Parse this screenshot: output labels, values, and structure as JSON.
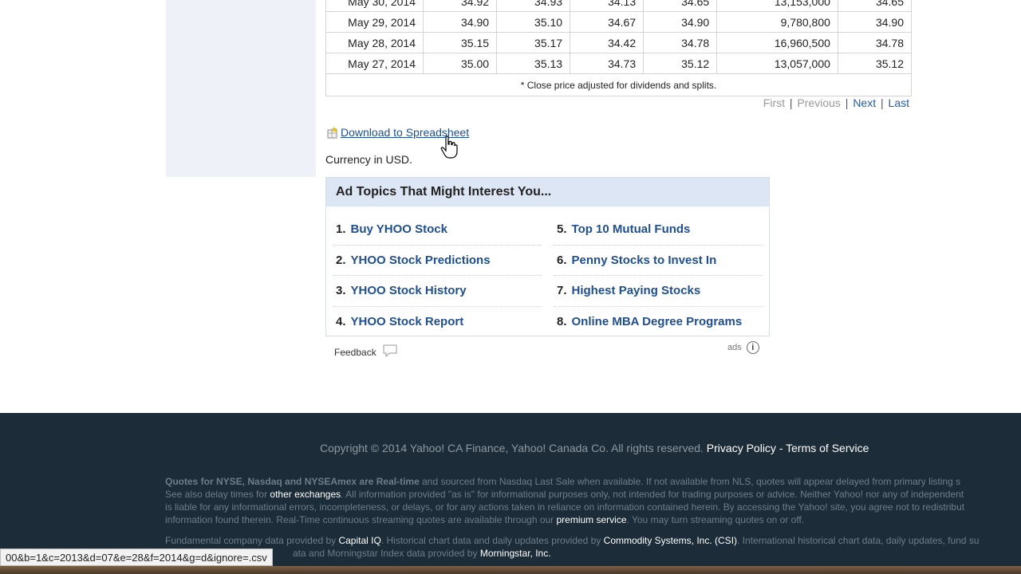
{
  "history_table": {
    "rows": [
      {
        "date": "May 30, 2014",
        "open": "34.92",
        "high": "34.93",
        "low": "34.13",
        "close": "34.65",
        "volume": "13,153,000",
        "adj_close": "34.65"
      },
      {
        "date": "May 29, 2014",
        "open": "34.90",
        "high": "35.10",
        "low": "34.67",
        "close": "34.90",
        "volume": "9,780,800",
        "adj_close": "34.90"
      },
      {
        "date": "May 28, 2014",
        "open": "35.15",
        "high": "35.17",
        "low": "34.42",
        "close": "34.78",
        "volume": "16,960,500",
        "adj_close": "34.78"
      },
      {
        "date": "May 27, 2014",
        "open": "35.00",
        "high": "35.13",
        "low": "34.73",
        "close": "35.12",
        "volume": "13,057,000",
        "adj_close": "35.12"
      }
    ],
    "footnote": "* Close price adjusted for dividends and splits."
  },
  "pager": {
    "first": "First",
    "previous": "Previous",
    "next": "Next",
    "last": "Last",
    "separator": "|"
  },
  "download": {
    "label": "Download to Spreadsheet"
  },
  "currency": "Currency in USD.",
  "ad_topics": {
    "title": "Ad Topics That Might Interest You...",
    "items": [
      {
        "num": "1.",
        "label": "Buy YHOO Stock"
      },
      {
        "num": "2.",
        "label": "YHOO Stock Predictions"
      },
      {
        "num": "3.",
        "label": "YHOO Stock History"
      },
      {
        "num": "4.",
        "label": "YHOO Stock Report"
      },
      {
        "num": "5.",
        "label": "Top 10 Mutual Funds"
      },
      {
        "num": "6.",
        "label": "Penny Stocks to Invest In"
      },
      {
        "num": "7.",
        "label": "Highest Paying Stocks"
      },
      {
        "num": "8.",
        "label": "Online MBA Degree Programs"
      }
    ],
    "feedback": "Feedback",
    "ads_label": "ads",
    "info_glyph": "i"
  },
  "footer": {
    "copyright": "Copyright © 2014 Yahoo! CA Finance, Yahoo! Canada Co. All rights reserved.",
    "privacy": "Privacy Policy",
    "dash": "-",
    "terms": "Terms of Service",
    "disclaimer_bold": "Quotes for NYSE, Nasdaq and NYSEAmex are Real-time",
    "disclaimer_1": " and sourced from Nasdaq Last Sale when available. If not available from NLS, quotes will appear delayed from primary listing s",
    "disclaimer_2a": "See also delay times for ",
    "other_exchanges": "other exchanges",
    "disclaimer_2b": ". All information provided \"as is\" for informational purposes only, not intended for trading purposes or advice. Neither Yahoo! nor any of independent",
    "disclaimer_3": "is liable for any informational errors, incompleteness, or delays, or for any actions taken in reliance on information contained herein. By accessing the Yahoo! site, you agree not to redistribut",
    "disclaimer_4a": "information found therein. Real-Time continuous streaming quotes are available through our ",
    "premium_service": "premium service",
    "disclaimer_4b": ". You may turn streaming quotes on or off.",
    "fund_1a": "Fundamental company data provided by ",
    "capital_iq": "Capital IQ",
    "fund_1b": ". Historical chart data and daily updates provided by ",
    "csi": "Commodity Systems, Inc. (CSI)",
    "fund_1c": ". International historical chart data, daily updates, fund su",
    "fund_2a": "ata and Morningstar Index data provided by ",
    "morningstar": "Morningstar, Inc."
  },
  "status_bar": {
    "url": "00&b=1&c=2013&d=07&e=28&f=2014&g=d&ignore=.csv"
  }
}
